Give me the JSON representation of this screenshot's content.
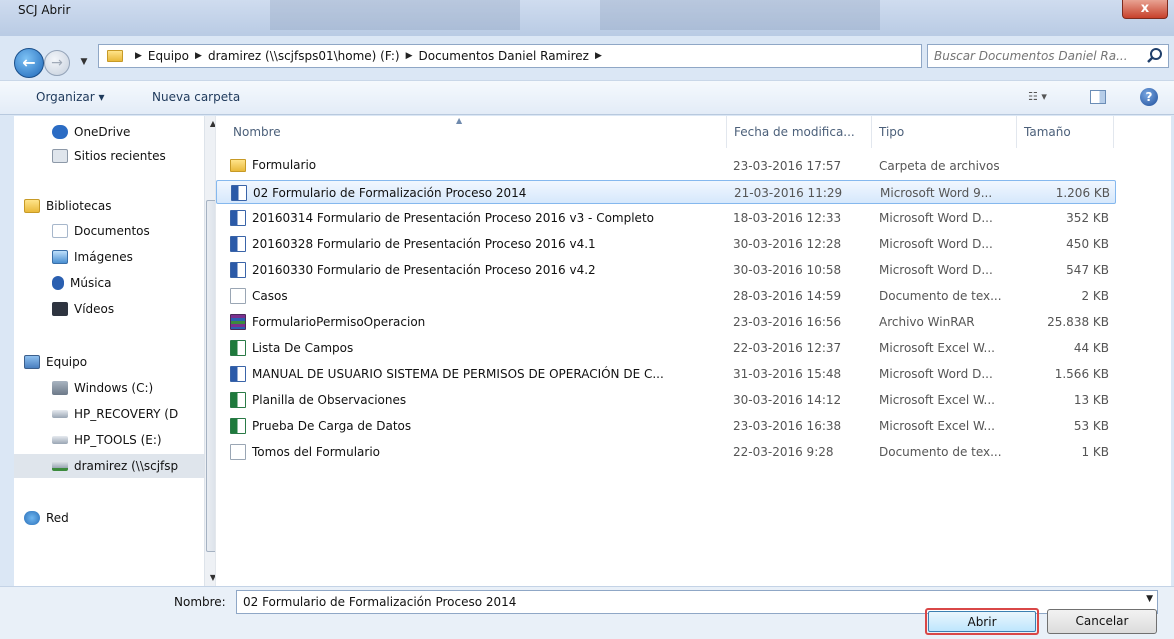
{
  "window": {
    "title": "SCJ Abrir",
    "close_label": "x"
  },
  "nav": {
    "back_symbol": "←",
    "forward_symbol": "→",
    "address": {
      "segments": [
        "Equipo",
        "dramirez (\\\\scjfsps01\\home) (F:)",
        "Documentos Daniel Ramirez"
      ]
    },
    "refresh_symbol": "↻",
    "search": {
      "placeholder": "Buscar Documentos Daniel Ra..."
    }
  },
  "toolbar": {
    "organize": "Organizar ▾",
    "new_folder": "Nueva carpeta",
    "views": "☷ ▾",
    "help": "?"
  },
  "sidebar": {
    "items": [
      {
        "label": "OneDrive",
        "icon": "cloud-icon",
        "color": "#2b6cc4"
      },
      {
        "label": "Sitios recientes",
        "icon": "recent-places-icon",
        "color": "#8d99a8"
      },
      {
        "label": "Bibliotecas",
        "icon": "libraries-icon",
        "color": "#e9b93a"
      },
      {
        "label": "Documentos",
        "icon": "documents-icon",
        "color": "#a7b7cb"
      },
      {
        "label": "Imágenes",
        "icon": "pictures-icon",
        "color": "#4a8fd1"
      },
      {
        "label": "Música",
        "icon": "music-icon",
        "color": "#2a5fb0"
      },
      {
        "label": "Vídeos",
        "icon": "videos-icon",
        "color": "#2e3440"
      },
      {
        "label": "Equipo",
        "icon": "computer-icon",
        "color": "#4a7fbf"
      },
      {
        "label": "Windows (C:)",
        "icon": "drive-icon",
        "color": "#7a8898"
      },
      {
        "label": "HP_RECOVERY (D",
        "icon": "drive-icon",
        "color": "#9aa6b4"
      },
      {
        "label": "HP_TOOLS (E:)",
        "icon": "drive-icon",
        "color": "#9aa6b4"
      },
      {
        "label": "dramirez (\\\\scjfsp",
        "icon": "network-drive-icon",
        "color": "#3c8a3c"
      },
      {
        "label": "Red",
        "icon": "network-icon",
        "color": "#2a6fb8"
      }
    ]
  },
  "columns": {
    "name": "Nombre",
    "date": "Fecha de modifica...",
    "type": "Tipo",
    "size": "Tamaño"
  },
  "files": [
    {
      "name": "Formulario",
      "date": "23-03-2016 17:57",
      "type": "Carpeta de archivos",
      "size": "",
      "icon": "folder-icon"
    },
    {
      "name": "02 Formulario de Formalización Proceso 2014",
      "date": "21-03-2016 11:29",
      "type": "Microsoft Word 9...",
      "size": "1.206 KB",
      "icon": "word-doc-icon",
      "selected": true
    },
    {
      "name": "20160314 Formulario de Presentación Proceso 2016 v3 - Completo",
      "date": "18-03-2016 12:33",
      "type": "Microsoft Word D...",
      "size": "352 KB",
      "icon": "word-doc-icon"
    },
    {
      "name": "20160328 Formulario de Presentación Proceso 2016 v4.1",
      "date": "30-03-2016 12:28",
      "type": "Microsoft Word D...",
      "size": "450 KB",
      "icon": "word-doc-icon"
    },
    {
      "name": "20160330 Formulario de Presentación Proceso 2016 v4.2",
      "date": "30-03-2016 10:58",
      "type": "Microsoft Word D...",
      "size": "547 KB",
      "icon": "word-doc-icon"
    },
    {
      "name": "Casos",
      "date": "28-03-2016 14:59",
      "type": "Documento de tex...",
      "size": "2 KB",
      "icon": "text-file-icon"
    },
    {
      "name": "FormularioPermisoOperacion",
      "date": "23-03-2016 16:56",
      "type": "Archivo WinRAR",
      "size": "25.838 KB",
      "icon": "winrar-icon"
    },
    {
      "name": "Lista De Campos",
      "date": "22-03-2016 12:37",
      "type": "Microsoft Excel W...",
      "size": "44 KB",
      "icon": "excel-icon"
    },
    {
      "name": "MANUAL DE USUARIO SISTEMA DE PERMISOS DE OPERACIÓN DE C...",
      "date": "31-03-2016 15:48",
      "type": "Microsoft Word D...",
      "size": "1.566 KB",
      "icon": "word-doc-icon"
    },
    {
      "name": "Planilla de Observaciones",
      "date": "30-03-2016 14:12",
      "type": "Microsoft Excel W...",
      "size": "13 KB",
      "icon": "excel-icon"
    },
    {
      "name": "Prueba De Carga de Datos",
      "date": "23-03-2016 16:38",
      "type": "Microsoft Excel W...",
      "size": "53 KB",
      "icon": "excel-icon"
    },
    {
      "name": "Tomos del Formulario",
      "date": "22-03-2016 9:28",
      "type": "Documento de tex...",
      "size": "1 KB",
      "icon": "text-file-icon"
    }
  ],
  "footer": {
    "filename_label": "Nombre:",
    "filename_value": "02 Formulario de Formalización Proceso 2014",
    "open_label": "Abrir",
    "cancel_label": "Cancelar"
  }
}
